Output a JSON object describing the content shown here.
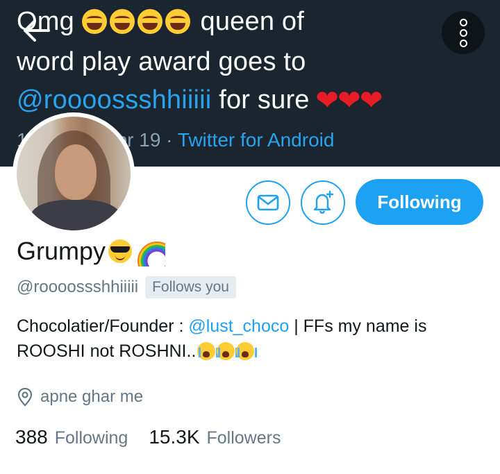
{
  "banner": {
    "line1_prefix": "Omg",
    "line1_suffix": "queen of",
    "line2": "word play award goes to",
    "line3_mention": "@roooossshhiiiii",
    "line3_suffix": "for sure",
    "meta_date": "1",
    "meta_date_tail": "pr 19 · ",
    "meta_source": "Twitter for Android",
    "laugh_emoji_count": 4,
    "heart_emoji_count": 3
  },
  "actions": {
    "message_icon": "mail-icon",
    "notify_icon": "bell-plus-icon",
    "follow_label": "Following"
  },
  "profile": {
    "name": "Grumpy",
    "name_emojis": [
      "sunglasses-emoji",
      "rainbow-emoji"
    ],
    "handle": "@roooossshhiiiii",
    "follows_you": "Follows you",
    "bio_prefix": "Chocolatier/Founder : ",
    "bio_link": "@lust_choco",
    "bio_middle": " | FFs my name is",
    "bio_line2": "ROOSHI not ROSHNI..",
    "location": "apne ghar me",
    "following_count": "388",
    "following_label": "Following",
    "followers_count": "15.3K",
    "followers_label": "Followers"
  },
  "colors": {
    "accent": "#1da1f2",
    "banner_bg": "#1a2530",
    "muted": "#657786"
  }
}
